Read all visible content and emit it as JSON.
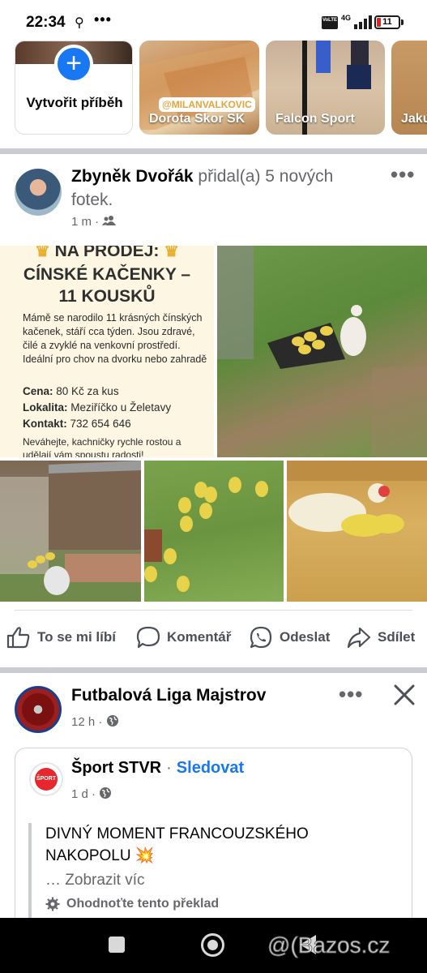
{
  "status": {
    "time": "22:34",
    "network": "4G",
    "volte": "VoLTE",
    "battery": "11"
  },
  "stories": [
    {
      "label": "Vytvořit příběh"
    },
    {
      "label": "Dorota Skor SK",
      "watermark": "@MILANVALKOVIC"
    },
    {
      "label": "Falcon Sport"
    },
    {
      "label": "Jakub"
    }
  ],
  "post1": {
    "author": "Zbyněk Dvořák",
    "action": "přidal(a) 5 nových fotek.",
    "time": "1 m",
    "audience_icon": "friends-icon",
    "ad": {
      "title_line1": "NA PRODEJ:",
      "title_line2": "CÍNSKÉ KAČENKY –",
      "title_line3": "11 KOUSKŮ",
      "body": "Mámě se narodilo 11 krásných čínských kačenek, stáří cca týden. Jsou zdravé, čilé a zvyklé na venkovní prostředí. Ideální pro chov na dvorku nebo zahradě",
      "price_label": "Cena:",
      "price": "80 Kč za kus",
      "location_label": "Lokalita:",
      "location": "Meziříčko u Želetavy",
      "contact_label": "Kontakt:",
      "contact": "732 654 646",
      "footer": "Neváhejte, kachničky rychle rostou a udělají vám spoustu radosti!"
    },
    "actions": {
      "like": "To se mi líbí",
      "comment": "Komentář",
      "send": "Odeslat",
      "share": "Sdílet"
    }
  },
  "post2": {
    "page": "Futbalová Liga Majstrov",
    "time": "12 h",
    "shared": {
      "page": "Šport STVR",
      "follow": "Sledovat",
      "time": "1 d",
      "text": "DIVNÝ MOMENT FRANCOUZSKÉHO NAKOPOLU 💥",
      "see_more": "… Zobrazit víc",
      "translate": "Ohodnoťte tento překlad"
    }
  },
  "overlay": {
    "bazos": "@(Bazos.cz"
  },
  "colors": {
    "accent": "#1877f2",
    "divider": "#c9ccd1",
    "secondary_text": "#65676b"
  }
}
